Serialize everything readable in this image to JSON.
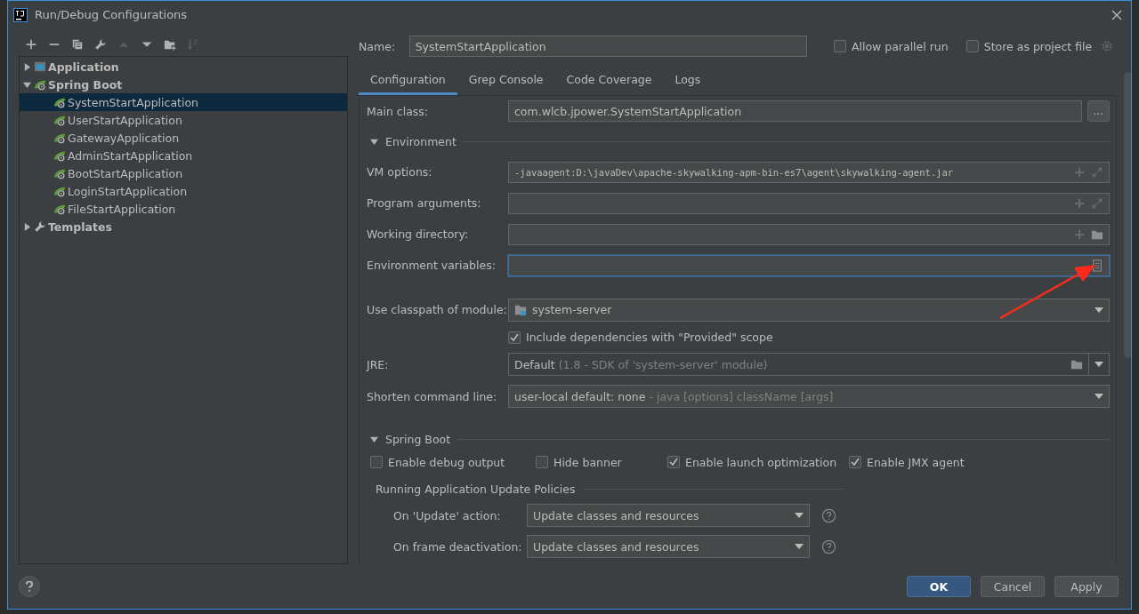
{
  "window": {
    "title": "Run/Debug Configurations"
  },
  "toolbar": [
    {
      "kind": "plus",
      "disabled": false
    },
    {
      "kind": "minus",
      "disabled": false
    },
    {
      "kind": "copy",
      "disabled": false
    },
    {
      "kind": "wrench",
      "disabled": false
    },
    {
      "kind": "up",
      "disabled": true
    },
    {
      "kind": "down",
      "disabled": false
    },
    {
      "kind": "folder",
      "disabled": false
    },
    {
      "kind": "sort",
      "disabled": true
    }
  ],
  "tree": [
    {
      "label": "Application",
      "kind": "application",
      "expanded": false,
      "selected": false
    },
    {
      "label": "Spring Boot",
      "kind": "spring",
      "expanded": true,
      "selected": false,
      "children": [
        {
          "label": "SystemStartApplication",
          "kind": "spring-app",
          "selected": true
        },
        {
          "label": "UserStartApplication",
          "kind": "spring-app",
          "selected": false
        },
        {
          "label": "GatewayApplication",
          "kind": "spring-app",
          "selected": false
        },
        {
          "label": "AdminStartApplication",
          "kind": "spring-app",
          "selected": false
        },
        {
          "label": "BootStartApplication",
          "kind": "spring-app",
          "selected": false
        },
        {
          "label": "LoginStartApplication",
          "kind": "spring-app",
          "selected": false
        },
        {
          "label": "FileStartApplication",
          "kind": "spring-app",
          "selected": false
        }
      ]
    },
    {
      "label": "Templates",
      "kind": "templates",
      "expanded": false,
      "selected": false
    }
  ],
  "name_field": {
    "label": "Name:",
    "value": "SystemStartApplication"
  },
  "header_options": [
    {
      "label": "Allow parallel run",
      "checked": false
    },
    {
      "label": "Store as project file",
      "checked": false
    }
  ],
  "tabs": [
    {
      "label": "Configuration",
      "selected": true
    },
    {
      "label": "Grep Console",
      "selected": false
    },
    {
      "label": "Code Coverage",
      "selected": false
    },
    {
      "label": "Logs",
      "selected": false
    }
  ],
  "main_class": {
    "label": "Main class:",
    "value": "com.wlcb.jpower.SystemStartApplication",
    "button": "..."
  },
  "environment_section": {
    "title": "Environment",
    "expanded": true
  },
  "fields": [
    {
      "label": "VM options:",
      "value": "-javaagent:D:\\javaDev\\apache-skywalking-apm-bin-es7\\agent\\skywalking-agent.jar",
      "kind": "expandable",
      "focused": false
    },
    {
      "label": "Program arguments:",
      "kind": "expandable",
      "focused": false
    },
    {
      "label": "Working directory:",
      "kind": "folder",
      "focused": false
    },
    {
      "label": "Environment variables:",
      "kind": "env",
      "focused": true
    }
  ],
  "module": {
    "label": "Use classpath of module:",
    "value": "system-server"
  },
  "include_dependencies": {
    "label": "Include dependencies with \"Provided\" scope",
    "checked": true
  },
  "jre": {
    "label": "JRE:",
    "value": "Default",
    "hint": "(1.8 - SDK of 'system-server' module)"
  },
  "shorten": {
    "label": "Shorten command line:",
    "value": "user-local default: none",
    "hint": "- java [options] className [args]"
  },
  "spring_boot_section": {
    "title": "Spring Boot",
    "expanded": true
  },
  "spring_options": [
    {
      "label": "Enable debug output",
      "checked": false
    },
    {
      "label": "Hide banner",
      "checked": false
    },
    {
      "label": "Enable launch optimization",
      "checked": true
    },
    {
      "label": "Enable JMX agent",
      "checked": true
    }
  ],
  "update_policies": {
    "title": "Running Application Update Policies",
    "rows": [
      {
        "label": "On 'Update' action:",
        "value": "Update classes and resources"
      },
      {
        "label": "On frame deactivation:",
        "value": "Update classes and resources"
      }
    ]
  },
  "buttons": [
    {
      "label": "OK",
      "default": true
    },
    {
      "label": "Cancel",
      "default": false
    },
    {
      "label": "Apply",
      "default": false
    }
  ]
}
